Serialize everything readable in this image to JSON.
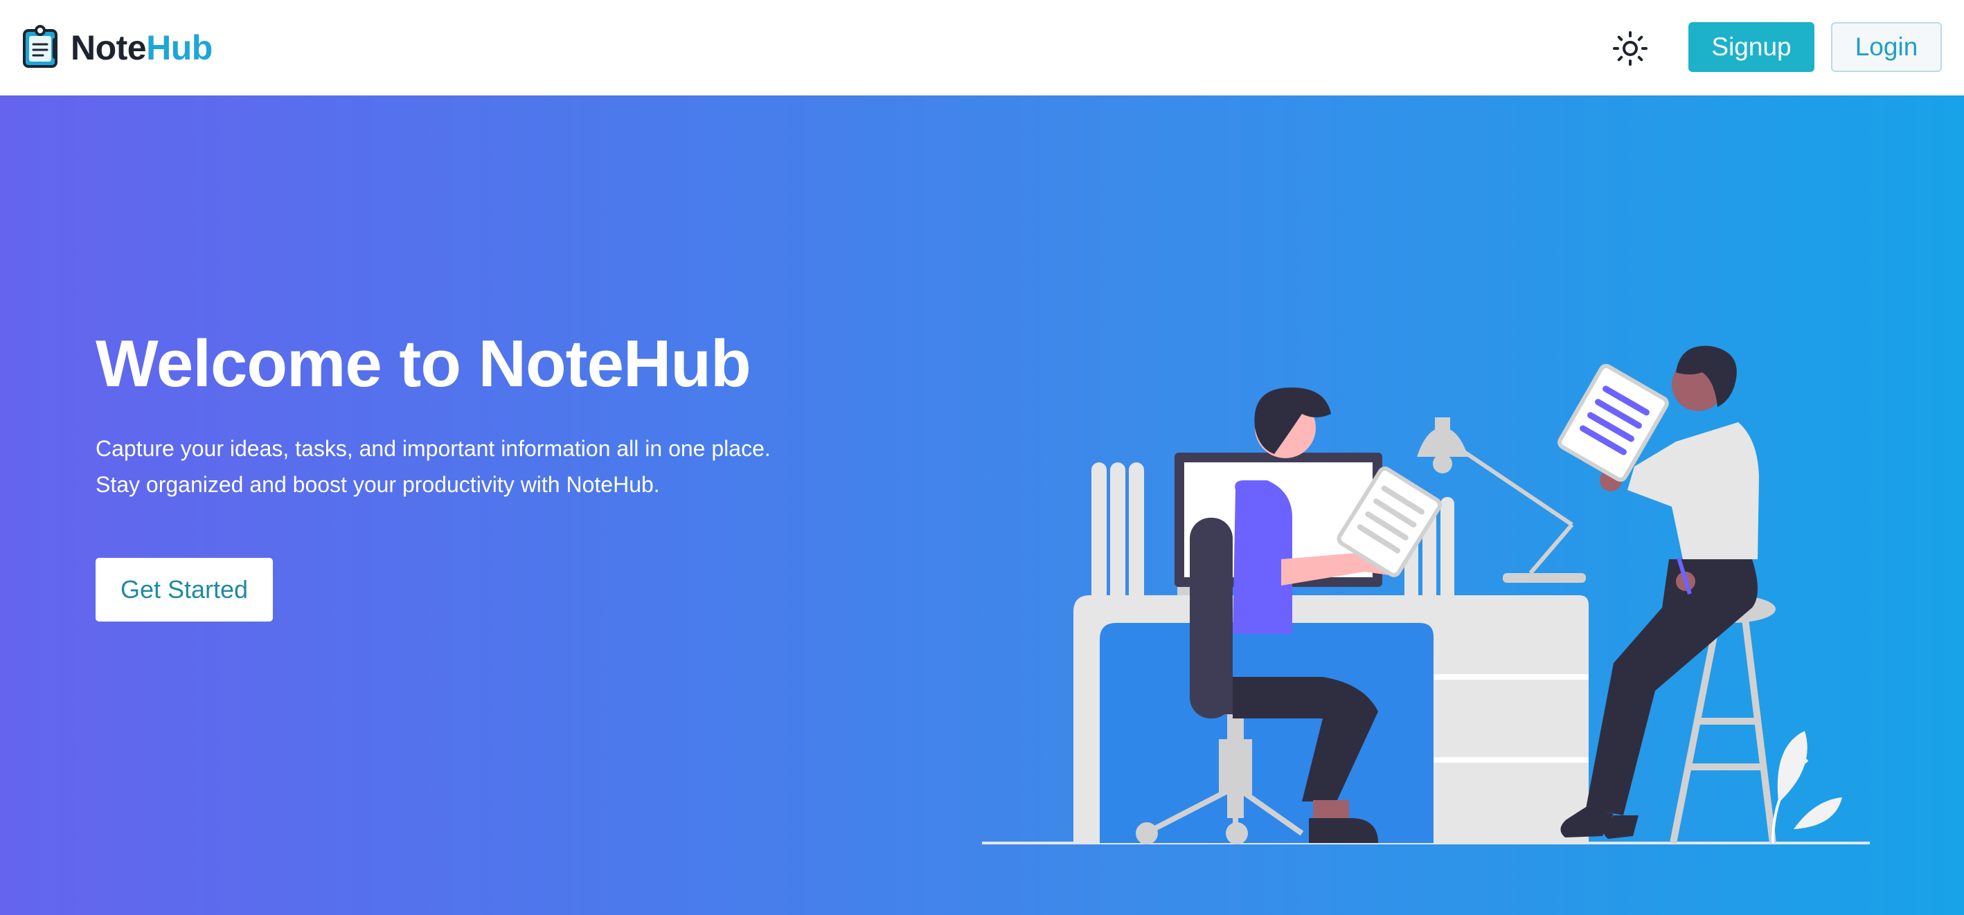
{
  "brand": {
    "name_part1": "Note",
    "name_part2": "Hub",
    "logo_icon": "notebook-icon",
    "accent_color": "#1ea6d6"
  },
  "nav": {
    "theme_toggle_icon": "sun-icon",
    "signup_label": "Signup",
    "login_label": "Login",
    "signup_color": "#1db2c9"
  },
  "hero": {
    "title": "Welcome to NoteHub",
    "description": "Capture your ideas, tasks, and important information all in one place. Stay organized and boost your productivity with NoteHub.",
    "cta_label": "Get Started",
    "gradient_start": "#6564ee",
    "gradient_end": "#18a2e8",
    "illustration": "office-workers-illustration"
  }
}
